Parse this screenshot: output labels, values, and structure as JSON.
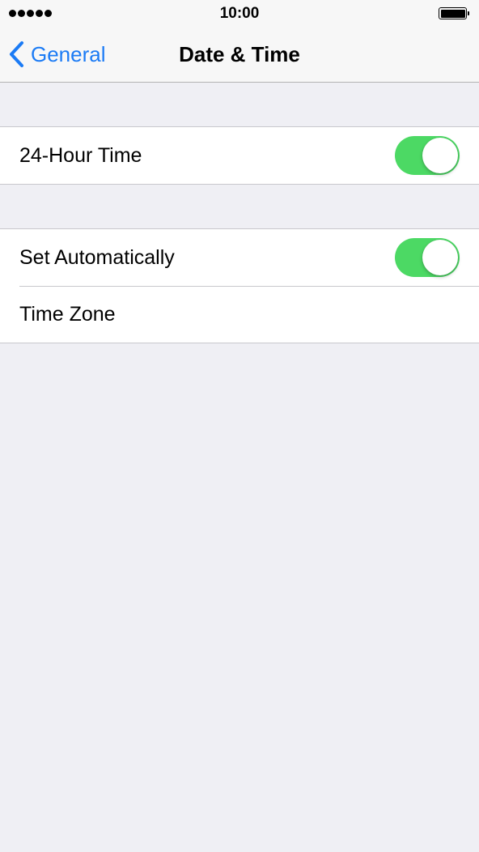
{
  "status_bar": {
    "time": "10:00",
    "signal_dots": 5,
    "signal_icon": "cellular-signal-dots-icon",
    "battery_icon": "battery-full-icon",
    "battery_level": 1.0
  },
  "nav": {
    "back_label": "General",
    "back_icon": "chevron-left-icon",
    "title": "Date & Time"
  },
  "groups": [
    {
      "rows": [
        {
          "label": "24-Hour Time",
          "toggle": true
        }
      ]
    },
    {
      "rows": [
        {
          "label": "Set Automatically",
          "toggle": true
        },
        {
          "label": "Time Zone"
        }
      ]
    }
  ],
  "colors": {
    "accent": "#1b7bf5",
    "toggle_on": "#4cd964",
    "background": "#efeff4"
  }
}
